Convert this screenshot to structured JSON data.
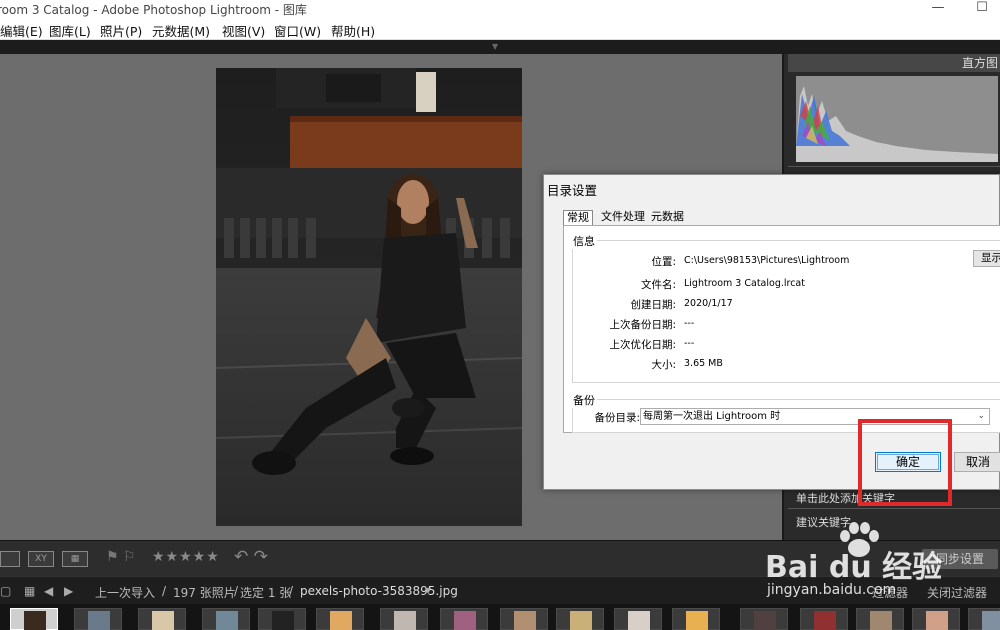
{
  "window": {
    "title": "room 3 Catalog - Adobe Photoshop Lightroom - 图库",
    "minimize": "—",
    "maximize": "☐"
  },
  "menubar": {
    "items": [
      "编辑(E)",
      "图库(L)",
      "照片(P)",
      "元数据(M)",
      "视图(V)",
      "窗口(W)",
      "帮助(H)"
    ]
  },
  "right_panel": {
    "histogram_title": "直方图",
    "keyword_add": "单击此处添加关键字",
    "keyword_suggest": "建议关键字"
  },
  "toolbar": {
    "stars": "★★★★★",
    "sync_settings": "同步设置"
  },
  "filmstrip": {
    "source": "上一次导入",
    "count": "197 张照片",
    "selected": "选定 1 张",
    "filename": "pexels-photo-3583895.jpg",
    "filter_label": "过滤器",
    "filter_off": "关闭过滤器",
    "separator": "/"
  },
  "dialog": {
    "title": "目录设置",
    "tabs": [
      "常规",
      "文件处理",
      "元数据"
    ],
    "info": {
      "group_label": "信息",
      "location_key": "位置:",
      "location_val": "C:\\Users\\98153\\Pictures\\Lightroom",
      "show_button": "显示",
      "filename_key": "文件名:",
      "filename_val": "Lightroom 3 Catalog.lrcat",
      "created_key": "创建日期:",
      "created_val": "2020/1/17",
      "last_backup_key": "上次备份日期:",
      "last_backup_val": "---",
      "last_optimize_key": "上次优化日期:",
      "last_optimize_val": "---",
      "size_key": "大小:",
      "size_val": "3.65 MB"
    },
    "backup": {
      "group_label": "备份",
      "key": "备份目录:",
      "value": "每周第一次退出 Lightroom 时"
    },
    "ok_button": "确定",
    "cancel_button": "取消"
  },
  "watermark": {
    "brand": "Bai du 经验",
    "url": "jingyan.baidu.com"
  }
}
